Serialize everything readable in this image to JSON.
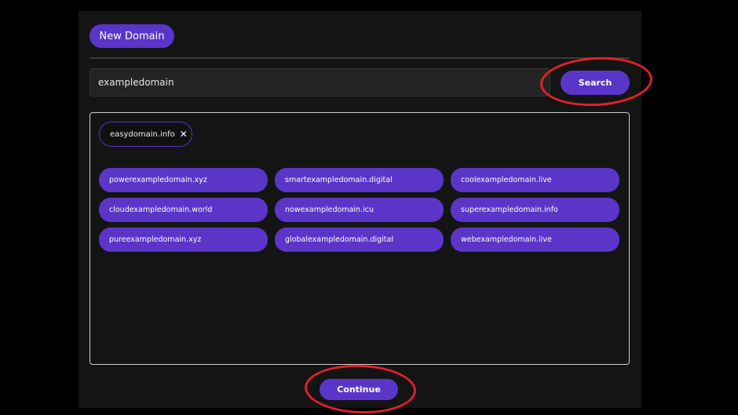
{
  "header": {
    "new_domain_label": "New Domain"
  },
  "search": {
    "value": "exampledomain",
    "button_label": "Search"
  },
  "selected": {
    "domain": "easydomain.info",
    "remove_glyph": "✕"
  },
  "suggestions": [
    "powerexampledomain.xyz",
    "smartexampledomain.digital",
    "coolexampledomain.live",
    "cloudexampledomain.world",
    "nowexampledomain.icu",
    "superexampledomain.info",
    "pureexampledomain.xyz",
    "globalexampledomain.digital",
    "webexampledomain.live"
  ],
  "footer": {
    "continue_label": "Continue"
  },
  "colors": {
    "accent": "#5b35c8",
    "annotation": "#e0202a",
    "panel": "#141414",
    "background": "#000000"
  }
}
